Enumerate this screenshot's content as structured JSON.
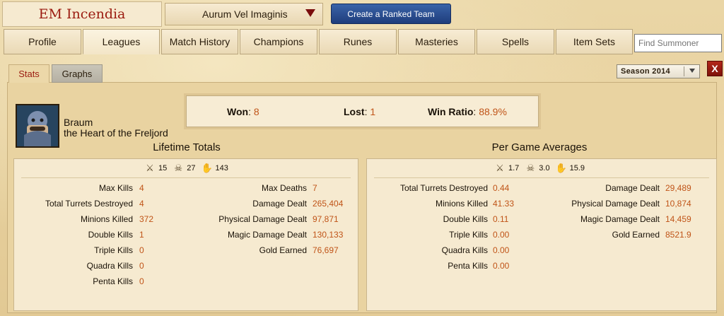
{
  "header": {
    "summoner_name": "EM Incendia",
    "team_select": "Aurum Vel Imaginis",
    "ranked_button": "Create a Ranked Team"
  },
  "tabs": [
    "Profile",
    "Leagues",
    "Match History",
    "Champions",
    "Runes",
    "Masteries",
    "Spells",
    "Item Sets"
  ],
  "active_tab": "Leagues",
  "search": {
    "placeholder": "Find Summoner"
  },
  "subtabs": {
    "stats": "Stats",
    "graphs": "Graphs"
  },
  "season": "Season 2014",
  "close_label": "X",
  "champion": {
    "name": "Braum",
    "title": "the Heart of the Freljord"
  },
  "record": {
    "won_label": "Won",
    "won": "8",
    "lost_label": "Lost",
    "lost": "1",
    "ratio_label": "Win Ratio",
    "ratio": "88.9%"
  },
  "lifetime": {
    "title": "Lifetime Totals",
    "icons": {
      "kills": "15",
      "deaths": "27",
      "assists": "143"
    },
    "left": [
      {
        "label": "Max Kills",
        "value": "4"
      },
      {
        "label": "Total Turrets Destroyed",
        "value": "4"
      },
      {
        "label": "Minions Killed",
        "value": "372"
      },
      {
        "label": "Double Kills",
        "value": "1"
      },
      {
        "label": "Triple Kills",
        "value": "0"
      },
      {
        "label": "Quadra Kills",
        "value": "0"
      },
      {
        "label": "Penta Kills",
        "value": "0"
      }
    ],
    "right": [
      {
        "label": "Max Deaths",
        "value": "7"
      },
      {
        "label": "Damage Dealt",
        "value": "265,404"
      },
      {
        "label": "Physical Damage Dealt",
        "value": "97,871"
      },
      {
        "label": "Magic Damage Dealt",
        "value": "130,133"
      },
      {
        "label": "Gold Earned",
        "value": "76,697"
      }
    ]
  },
  "averages": {
    "title": "Per Game Averages",
    "icons": {
      "kills": "1.7",
      "deaths": "3.0",
      "assists": "15.9"
    },
    "left": [
      {
        "label": "Total Turrets Destroyed",
        "value": "0.44"
      },
      {
        "label": "Minions Killed",
        "value": "41.33"
      },
      {
        "label": "Double Kills",
        "value": "0.11"
      },
      {
        "label": "Triple Kills",
        "value": "0.00"
      },
      {
        "label": "Quadra Kills",
        "value": "0.00"
      },
      {
        "label": "Penta Kills",
        "value": "0.00"
      }
    ],
    "right": [
      {
        "label": "Damage Dealt",
        "value": "29,489"
      },
      {
        "label": "Physical Damage Dealt",
        "value": "10,874"
      },
      {
        "label": "Magic Damage Dealt",
        "value": "14,459"
      },
      {
        "label": "Gold Earned",
        "value": "8521.9"
      }
    ]
  }
}
